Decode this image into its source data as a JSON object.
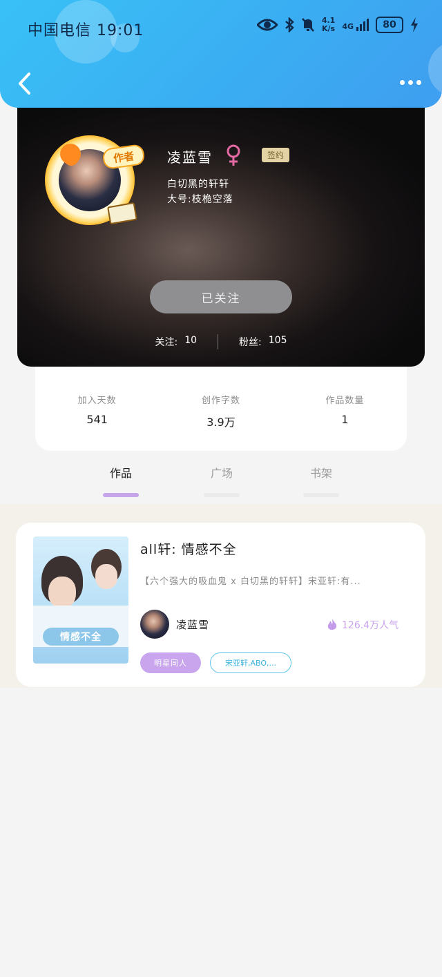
{
  "status_bar": {
    "carrier_time": "中国电信 19:01",
    "net_speed_value": "4.1",
    "net_speed_unit": "K/s",
    "network": "4G",
    "battery": "80"
  },
  "nav": {
    "back_icon": "chevron-left-icon",
    "more_icon": "more-dots-icon"
  },
  "profile": {
    "author_tag": "作者",
    "name": "凌蓝雪",
    "gender_icon": "female-icon",
    "badge": "签约",
    "bio_line1": "白切黑的轩轩",
    "bio_line2": "大号:枝桅空落",
    "follow_button": "已关注",
    "following_label": "关注:",
    "following_value": "10",
    "fans_label": "粉丝:",
    "fans_value": "105"
  },
  "stats": [
    {
      "label": "加入天数",
      "value": "541"
    },
    {
      "label": "创作字数",
      "value": "3.9万"
    },
    {
      "label": "作品数量",
      "value": "1"
    }
  ],
  "tabs": [
    {
      "label": "作品",
      "active": true
    },
    {
      "label": "广场",
      "active": false
    },
    {
      "label": "书架",
      "active": false
    }
  ],
  "work": {
    "cover_text": "情感不全",
    "title": "all轩: 情感不全",
    "description": "【六个强大的吸血鬼 x 白切黑的轩轩】宋亚轩:有...",
    "author": "凌蓝雪",
    "popularity": "126.4万人气",
    "tag_primary": "明星同人",
    "tag_secondary": "宋亚轩,ABO,..."
  },
  "colors": {
    "accent_purple": "#c8a5ec",
    "top_blue": "#3aaef2",
    "tag_blue": "#35b2dd"
  }
}
